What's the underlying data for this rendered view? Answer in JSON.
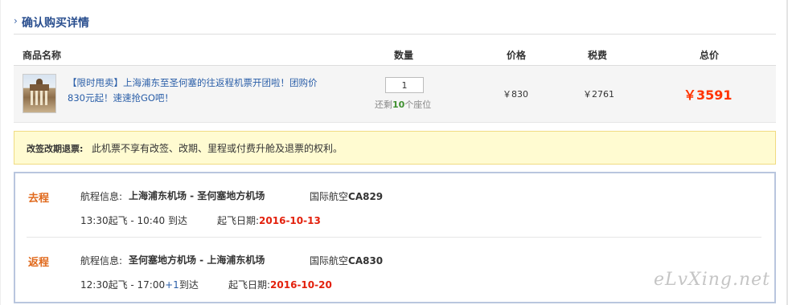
{
  "header": {
    "title": "确认购买详情"
  },
  "columns": {
    "product": "商品名称",
    "quantity": "数量",
    "price": "价格",
    "tax": "税费",
    "total": "总价"
  },
  "item": {
    "title": "【限时甩卖】上海浦东至圣何塞的往返程机票开团啦！团购价830元起！速速抢GO吧！",
    "quantity": "1",
    "remain_prefix": "还剩",
    "remain_count": "10",
    "remain_suffix": "个座位",
    "price": "￥830",
    "tax": "￥2761",
    "total": "￥3591"
  },
  "notice": {
    "label": "改签改期退票:",
    "text": "此机票不享有改签、改期、里程或付费升舱及退票的权利。"
  },
  "flights": {
    "outbound": {
      "label": "去程",
      "route_label": "航程信息:",
      "route": "上海浦东机场 - 圣何塞地方机场",
      "airline": "国际航空",
      "flight_no": "CA829",
      "depart": "13:30起飞 - 10:40 到达",
      "date_label": "起飞日期:",
      "date": "2016-10-13"
    },
    "return": {
      "label": "返程",
      "route_label": "航程信息:",
      "route": "圣何塞地方机场 - 上海浦东机场",
      "airline": "国际航空",
      "flight_no": "CA830",
      "depart": "12:30起飞 - 17:00",
      "plus_day": "+1",
      "arrive_suffix": "到达",
      "date_label": "起飞日期:",
      "date": "2016-10-20"
    }
  },
  "watermark": "eLvXing.net",
  "colors": {
    "accent_blue": "#2a4f8f",
    "total_red": "#ff3300",
    "leg_orange": "#e0691c",
    "date_red": "#e3200c"
  }
}
